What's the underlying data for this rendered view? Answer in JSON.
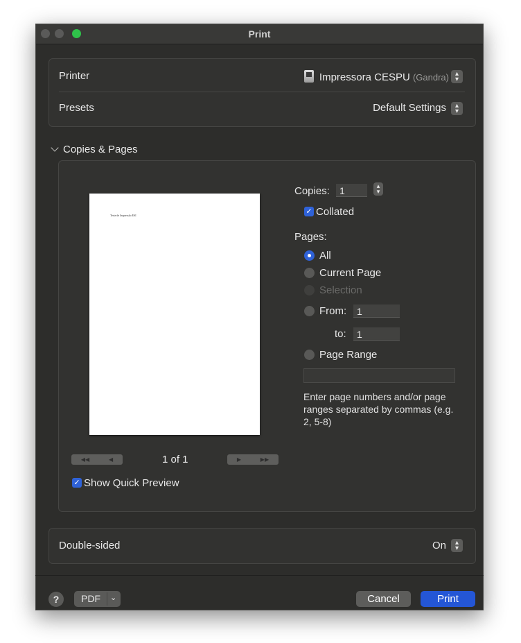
{
  "window": {
    "title": "Print"
  },
  "printer": {
    "label": "Printer",
    "value": "Impressora CESPU",
    "location": "(Gandra)",
    "icon": "printer-icon"
  },
  "presets": {
    "label": "Presets",
    "value": "Default Settings"
  },
  "section": {
    "title": "Copies & Pages"
  },
  "preview": {
    "page_text": "Teste de Impressão ESI",
    "page_count": "1 of 1",
    "quick_preview_label": "Show Quick Preview",
    "quick_preview_checked": true
  },
  "copies": {
    "label": "Copies:",
    "value": "1",
    "collated_label": "Collated",
    "collated_checked": true
  },
  "pages": {
    "label": "Pages:",
    "options": [
      {
        "label": "All",
        "selected": true,
        "enabled": true
      },
      {
        "label": "Current Page",
        "selected": false,
        "enabled": true
      },
      {
        "label": "Selection",
        "selected": false,
        "enabled": false
      },
      {
        "label": "From:",
        "selected": false,
        "enabled": true
      },
      {
        "label": "Page Range",
        "selected": false,
        "enabled": true
      }
    ],
    "from_value": "1",
    "to_label": "to:",
    "to_value": "1",
    "range_value": "",
    "hint": "Enter page numbers and/or page ranges separated by commas (e.g. 2, 5-8)"
  },
  "double_sided": {
    "label": "Double-sided",
    "value": "On"
  },
  "footer": {
    "help_label": "?",
    "pdf_label": "PDF",
    "cancel_label": "Cancel",
    "print_label": "Print"
  },
  "colors": {
    "accent": "#2456d6",
    "window_bg": "#2d2d2b",
    "maximize": "#2fc24a"
  }
}
